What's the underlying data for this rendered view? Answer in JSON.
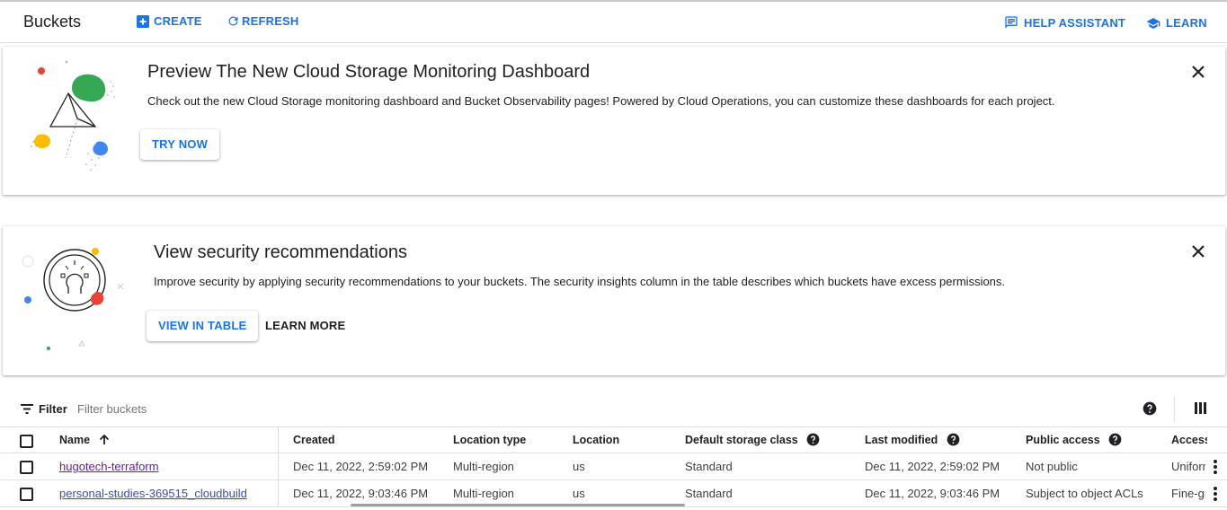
{
  "header": {
    "title": "Buckets",
    "create_label": "CREATE",
    "refresh_label": "REFRESH",
    "help_label": "HELP ASSISTANT",
    "learn_label": "LEARN"
  },
  "banner_monitoring": {
    "title": "Preview The New Cloud Storage Monitoring Dashboard",
    "description": "Check out the new Cloud Storage monitoring dashboard and Bucket Observability pages! Powered by Cloud Operations, you can customize these dashboards for each project.",
    "button_label": "TRY NOW"
  },
  "banner_security": {
    "title": "View security recommendations",
    "description": "Improve security by applying security recommendations to your buckets. The security insights column in the table describes which buckets have excess permissions.",
    "primary_button_label": "VIEW IN TABLE",
    "secondary_button_label": "LEARN MORE"
  },
  "filter": {
    "label": "Filter",
    "placeholder": "Filter buckets"
  },
  "table": {
    "columns": [
      "Name",
      "Created",
      "Location type",
      "Location",
      "Default storage class",
      "Last modified",
      "Public access",
      "Access"
    ],
    "rows": [
      {
        "name": "hugotech-terraform",
        "created": "Dec 11, 2022, 2:59:02 PM",
        "location_type": "Multi-region",
        "location": "us",
        "storage_class": "Standard",
        "last_modified": "Dec 11, 2022, 2:59:02 PM",
        "public_access": "Not public",
        "access": "Uniform"
      },
      {
        "name": "personal-studies-369515_cloudbuild",
        "created": "Dec 11, 2022, 9:03:46 PM",
        "location_type": "Multi-region",
        "location": "us",
        "storage_class": "Standard",
        "last_modified": "Dec 11, 2022, 9:03:46 PM",
        "public_access": "Subject to object ACLs",
        "access": "Fine-grained"
      }
    ]
  },
  "colors": {
    "accent": "#1a73e8",
    "visited_link": "#681da8",
    "google_green": "#34a853",
    "google_yellow": "#fbbc04",
    "google_blue": "#4285f4",
    "google_red": "#ea4335"
  },
  "icons": {
    "create": "add-box-icon",
    "refresh": "refresh-icon",
    "help_assistant": "chat-icon",
    "learn": "school-icon",
    "close": "close-icon",
    "filter": "filter-list-icon",
    "help": "help-circle-icon",
    "columns": "column-display-icon",
    "sort": "arrow-up-icon",
    "row_menu": "more-vert-icon"
  }
}
